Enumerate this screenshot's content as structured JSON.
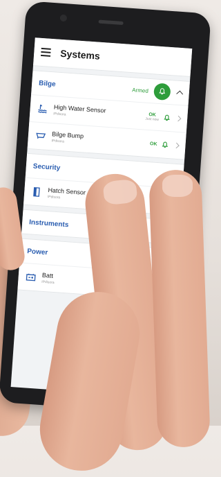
{
  "app": {
    "title": "Systems"
  },
  "sections": [
    {
      "title": "Bilge",
      "status": "Armed",
      "expanded": true,
      "items": [
        {
          "name": "High Water Sensor",
          "sub": "IPdisora",
          "status": "OK",
          "status_sub": "Just now",
          "icon": "water-wave-icon"
        },
        {
          "name": "Bilge Bump",
          "sub": "IPdisora",
          "status": "OK",
          "status_sub": "",
          "icon": "pump-icon"
        }
      ]
    },
    {
      "title": "Security",
      "items": [
        {
          "name": "Hatch Sensor",
          "sub": "IPdisora",
          "icon": "door-icon"
        }
      ]
    },
    {
      "title": "Instruments",
      "items": []
    },
    {
      "title": "Power",
      "items": [
        {
          "name": "Batt",
          "sub": "IPdisora",
          "icon": "battery-icon"
        }
      ]
    }
  ],
  "colors": {
    "accent_blue": "#2a5db0",
    "ok_green": "#2e9d3b"
  }
}
